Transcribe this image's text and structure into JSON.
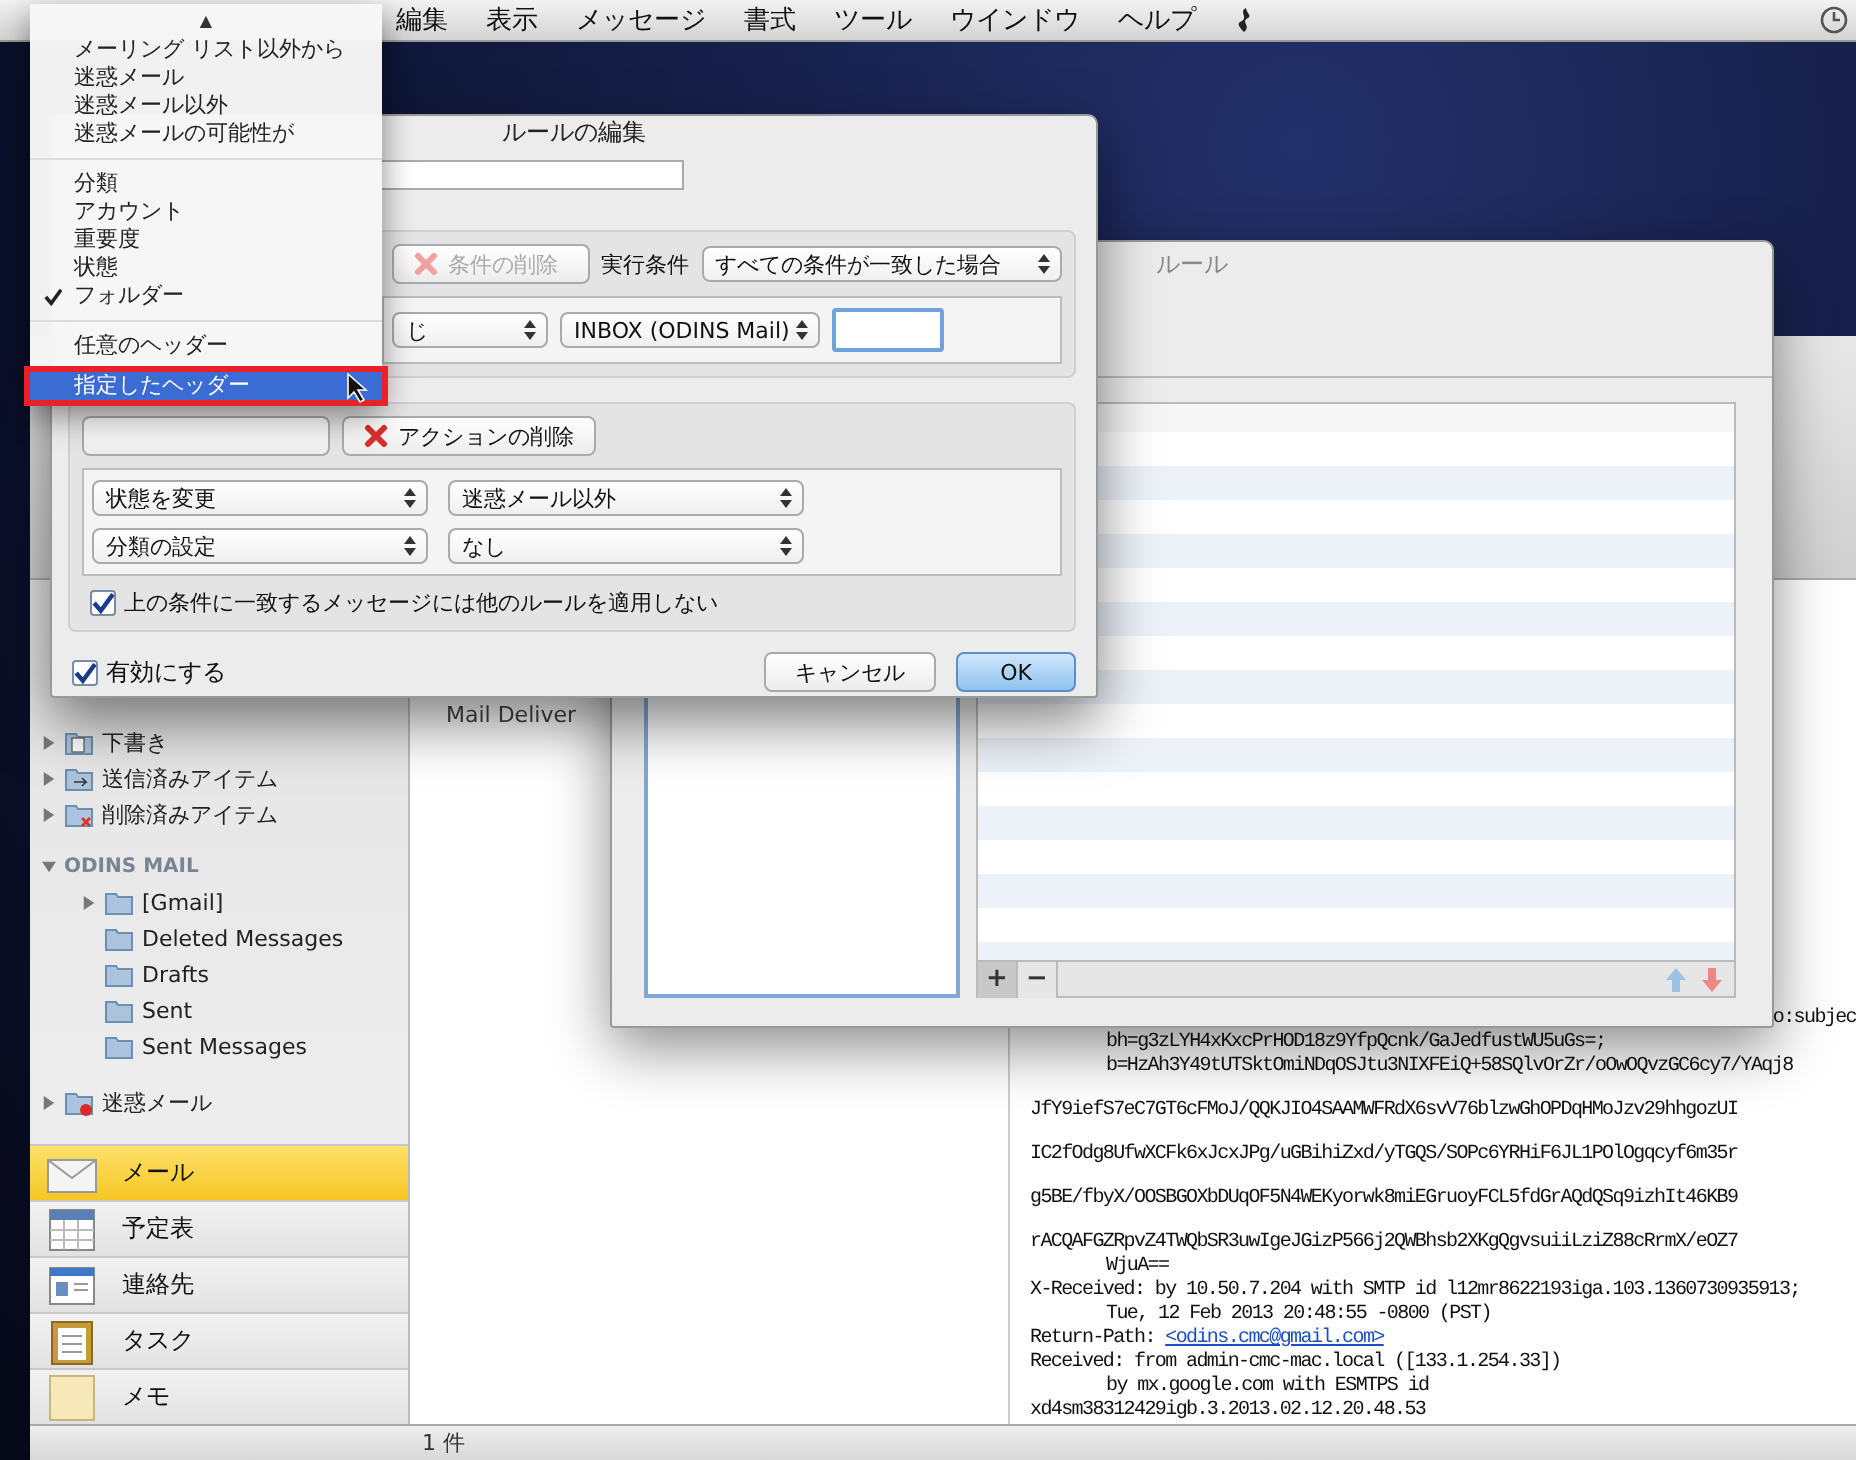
{
  "menu_bar": {
    "items": [
      "編集",
      "表示",
      "メッセージ",
      "書式",
      "ツール",
      "ウインドウ",
      "ヘルプ"
    ]
  },
  "popup_menu": {
    "scroll_arrow": "▲",
    "groups": [
      [
        {
          "label": "メーリング リスト以外から",
          "checked": false,
          "selected": false
        },
        {
          "label": "迷惑メール",
          "checked": false,
          "selected": false
        },
        {
          "label": "迷惑メール以外",
          "checked": false,
          "selected": false
        },
        {
          "label": "迷惑メールの可能性が",
          "checked": false,
          "selected": false
        }
      ],
      [
        {
          "label": "分類",
          "checked": false,
          "selected": false
        },
        {
          "label": "アカウント",
          "checked": false,
          "selected": false
        },
        {
          "label": "重要度",
          "checked": false,
          "selected": false
        },
        {
          "label": "状態",
          "checked": false,
          "selected": false
        },
        {
          "label": "フォルダー",
          "checked": true,
          "selected": false
        }
      ],
      [
        {
          "label": "任意のヘッダー",
          "checked": false,
          "selected": false
        },
        {
          "label": "指定したヘッダー",
          "checked": false,
          "selected": true
        }
      ]
    ]
  },
  "rule_editor": {
    "title": "ルールの編集",
    "conditions": {
      "delete_button": {
        "label": "条件の削除",
        "disabled": true
      },
      "match_label": "実行条件",
      "match_value": "すべての条件が一致した場合",
      "criterion": "じ",
      "folder": "INBOX (ODINS Mail)"
    },
    "actions": {
      "delete_button": {
        "label": "アクションの削除",
        "disabled": false
      },
      "rows": [
        {
          "action": "状態を変更",
          "value": "迷惑メール以外"
        },
        {
          "action": "分類の設定",
          "value": "なし"
        }
      ]
    },
    "stop_rules": {
      "label": "上の条件に一致するメッセージには他のルールを適用しない",
      "checked": true
    },
    "enabled": {
      "label": "有効にする",
      "checked": true
    },
    "buttons": [
      {
        "label": "キャンセル",
        "default": false
      },
      {
        "label": "OK",
        "default": true
      }
    ]
  },
  "rules_window": {
    "title": "ルール",
    "add": "+",
    "remove": "−"
  },
  "sidebar": {
    "folders": [
      {
        "label": "下書き",
        "kind": "drafts",
        "expanded": false
      },
      {
        "label": "送信済みアイテム",
        "kind": "sent",
        "expanded": false
      },
      {
        "label": "削除済みアイテム",
        "kind": "deleted",
        "expanded": false
      }
    ],
    "account": {
      "label": "ODINS MAIL",
      "expanded": true,
      "children": [
        {
          "label": "[Gmail]",
          "kind": "folder",
          "expanded": false
        },
        {
          "label": "Deleted Messages",
          "kind": "folder"
        },
        {
          "label": "Drafts",
          "kind": "folder"
        },
        {
          "label": "Sent",
          "kind": "folder"
        },
        {
          "label": "Sent Messages",
          "kind": "folder"
        }
      ]
    },
    "junk_folder": {
      "label": "迷惑メール",
      "kind": "junk",
      "expanded": false
    },
    "nav": [
      {
        "label": "メール",
        "kind": "mail",
        "selected": true
      },
      {
        "label": "予定表",
        "kind": "calendar",
        "selected": false
      },
      {
        "label": "連絡先",
        "kind": "contacts",
        "selected": false
      },
      {
        "label": "タスク",
        "kind": "tasks",
        "selected": false
      },
      {
        "label": "メモ",
        "kind": "notes",
        "selected": false
      }
    ]
  },
  "message_list": {
    "sender": "Mail Deliver"
  },
  "message_body": {
    "lines": [
      {
        "kind": "tail",
        "text": "o:subjec"
      },
      {
        "kind": "indented",
        "text": "bh=g3zLYH4xKxcPrHOD18z9YfpQcnk/GaJedfustWU5uGs=;"
      },
      {
        "kind": "indented",
        "text": "b=HzAh3Y49tUTSktOmiNDqOSJtu3NIXFEiQ+58SQlvOrZr/oOwOQvzGC6cy7/YAqj8"
      },
      {
        "kind": "spaced",
        "text": "JfY9iefS7eC7GT6cFMoJ/QQKJIO4SAAMWFRdX6svV76blzwGhOPDqHMoJzv29hhgozUI"
      },
      {
        "kind": "spaced",
        "text": "IC2fOdg8UfwXCFk6xJcxJPg/uGBihiZxd/yTGQS/SOPc6YRHiF6JL1POlOgqcyf6m35r"
      },
      {
        "kind": "spaced",
        "text": "g5BE/fbyX/OOSBGOXbDUqOF5N4WEKyorwk8miEGruoyFCL5fdGrAQdQSq9izhIt46KB9"
      },
      {
        "kind": "spaced",
        "text": "rACQAFGZRpvZ4TWQbSR3uwIgeJGizP566j2QWBhsb2XKgQgvsuiiLziZ88cRrmX/eOZ7"
      },
      {
        "kind": "indented",
        "text": "WjuA=="
      },
      {
        "kind": "plain",
        "text": "X-Received: by 10.50.7.204 with SMTP id l12mr8622193iga.103.1360730935913;"
      },
      {
        "kind": "indented",
        "text": "Tue, 12 Feb 2013 20:48:55 -0800 (PST)"
      },
      {
        "kind": "link",
        "text": "Return-Path: ",
        "link": "<odins.cmc@gmail.com>"
      },
      {
        "kind": "plain",
        "text": "Received: from admin-cmc-mac.local ([133.1.254.33])"
      },
      {
        "kind": "indented",
        "text": "by mx.google.com with ESMTPS id"
      },
      {
        "kind": "plain",
        "text": "xd4sm38312429igb.3.2013.02.12.20.48.53"
      }
    ]
  },
  "status_bar": {
    "count": "1 件"
  }
}
